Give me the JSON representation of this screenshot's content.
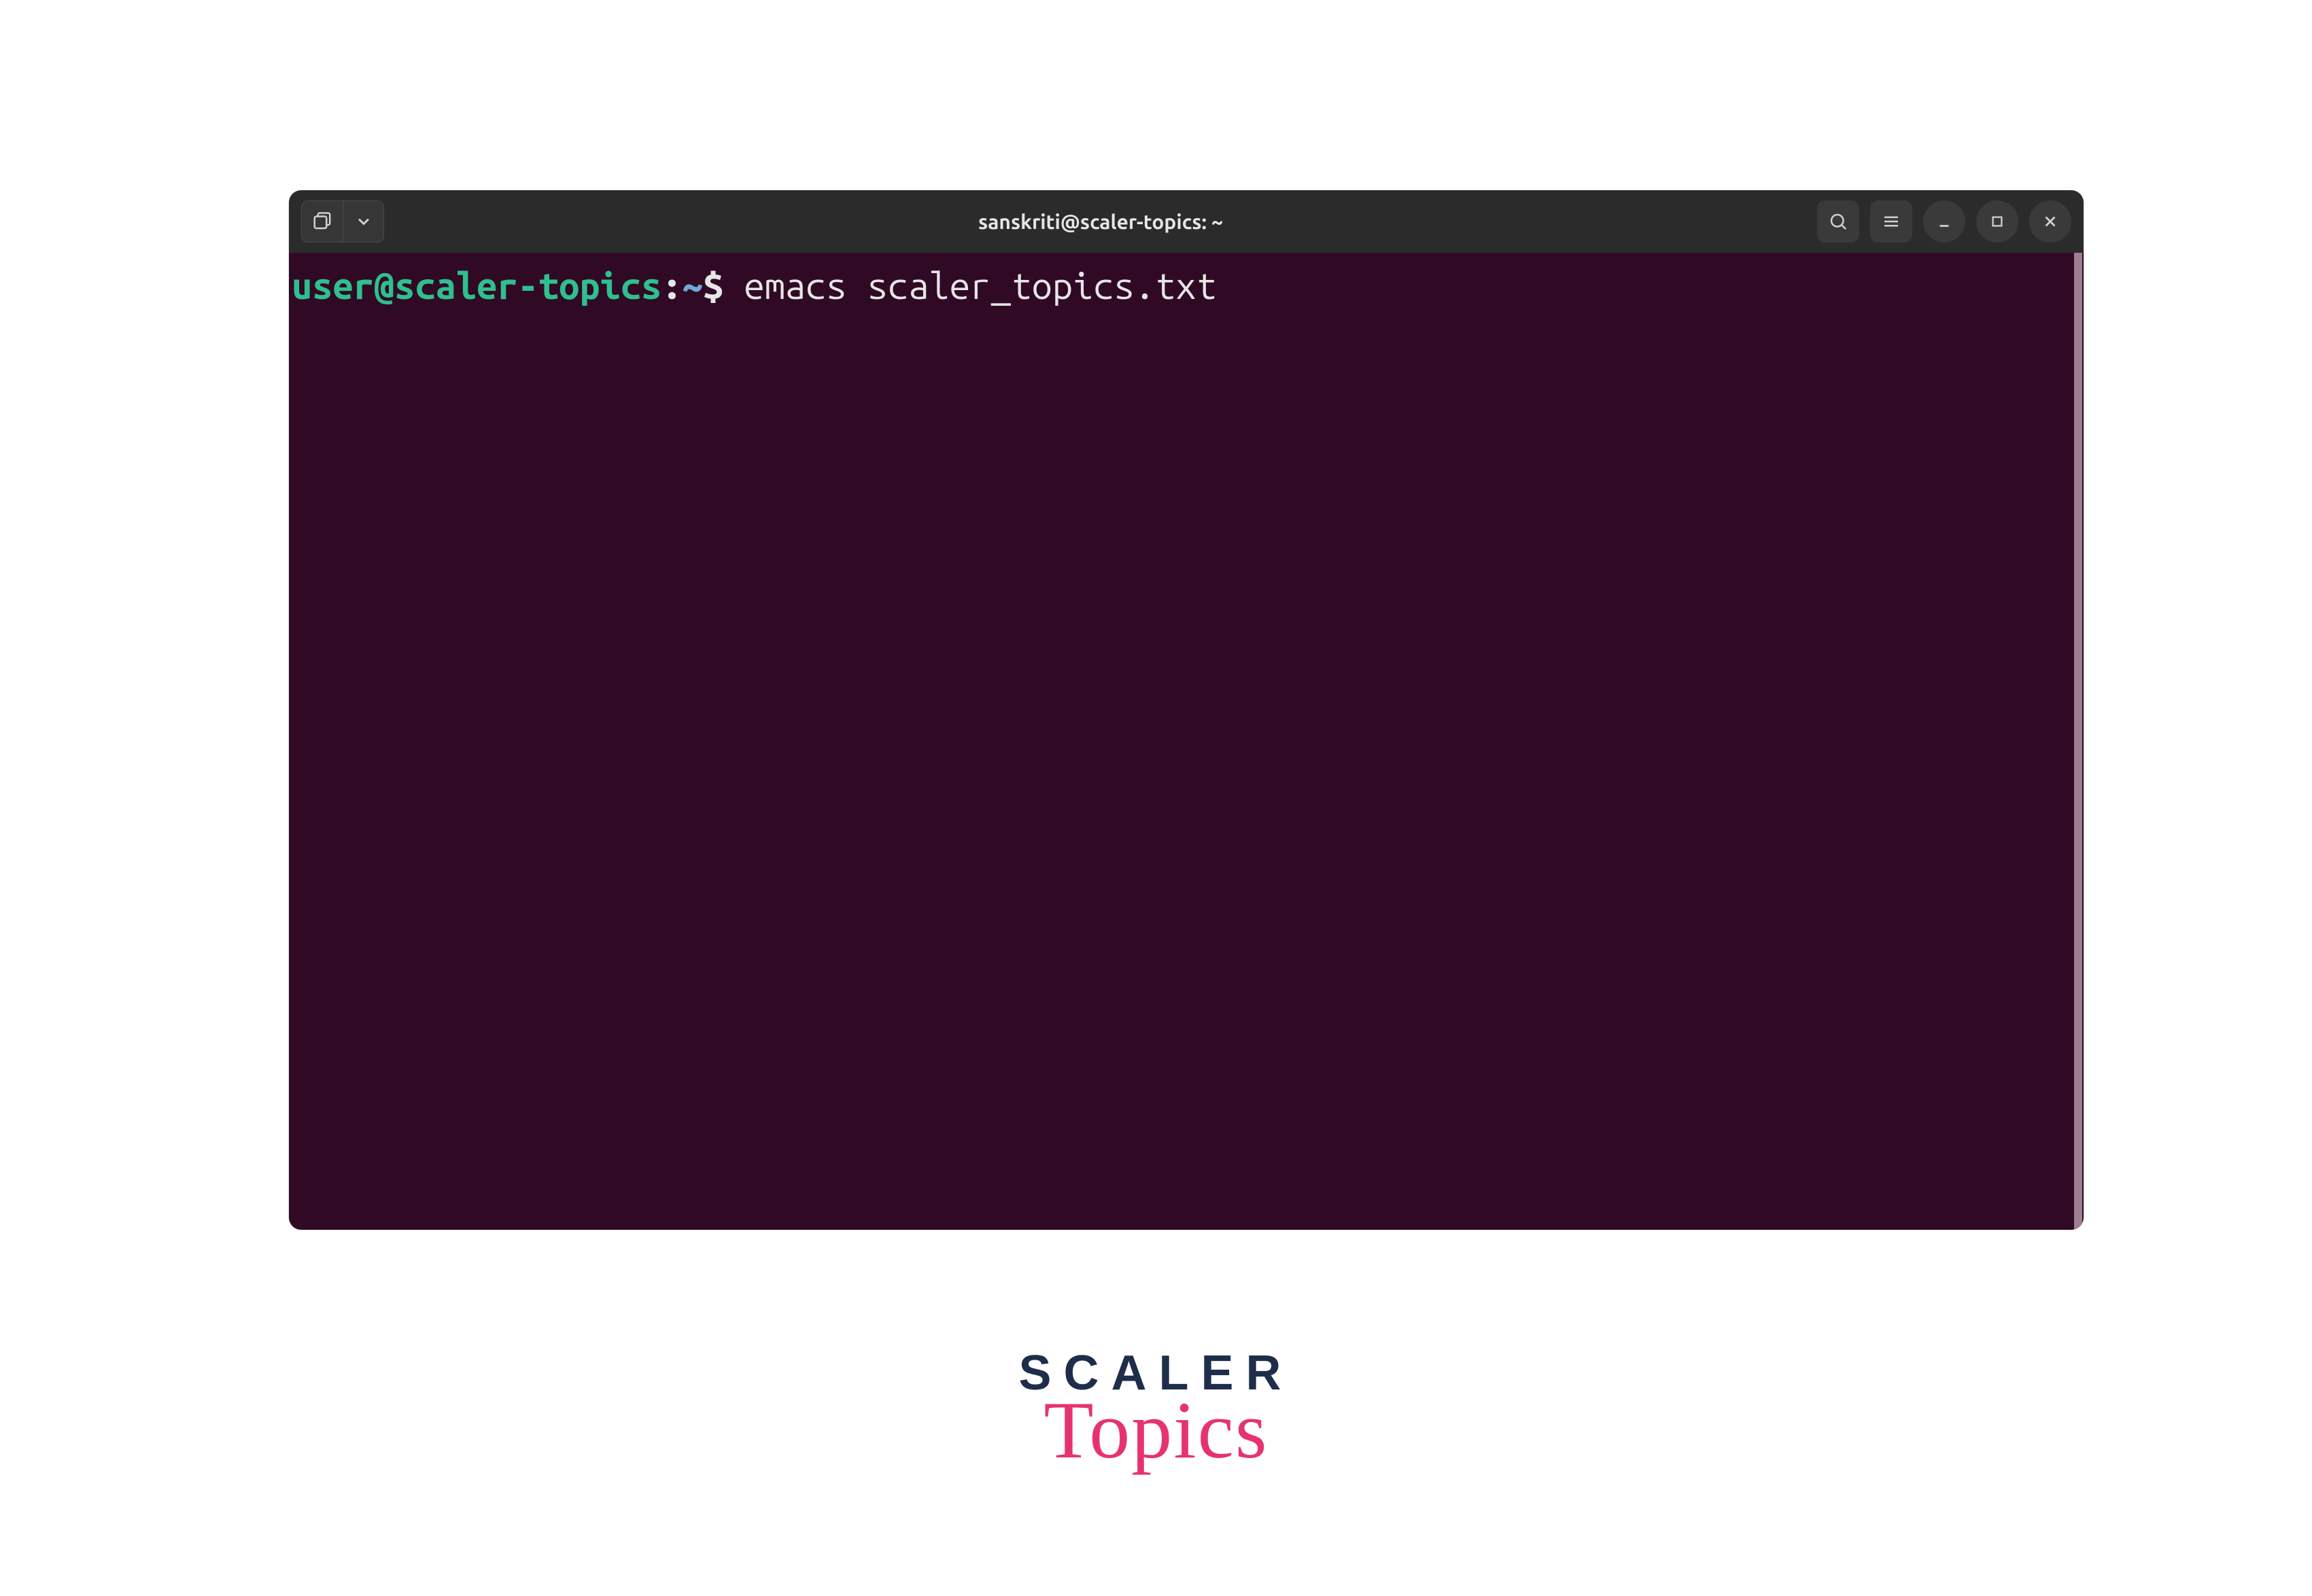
{
  "window": {
    "title": "sanskriti@scaler-topics: ~"
  },
  "prompt": {
    "user_host": "user@scaler-topics",
    "separator": ":",
    "path": "~",
    "symbol": "$",
    "command": "emacs scaler_topics.txt"
  },
  "logo": {
    "line1": "SCALER",
    "line2": "Topics"
  }
}
